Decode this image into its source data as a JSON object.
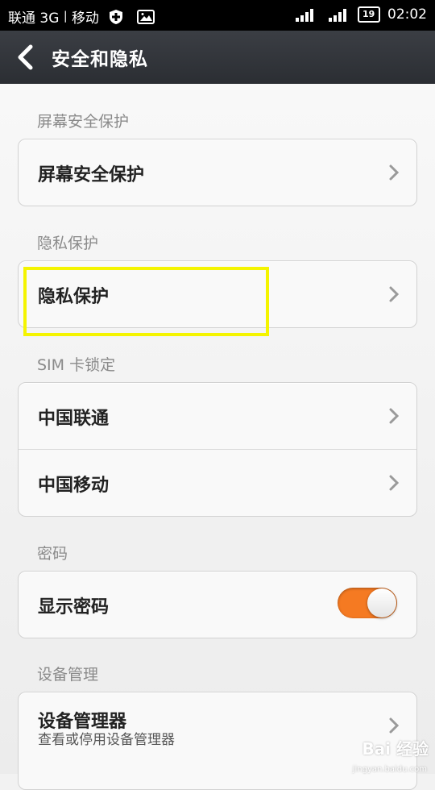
{
  "status_bar": {
    "carrier_text": "联通 3G",
    "separator": "|",
    "carrier2_text": "移动",
    "battery": "19",
    "time": "02:02"
  },
  "header": {
    "title": "安全和隐私"
  },
  "sections": [
    {
      "label": "屏幕安全保护",
      "rows": [
        {
          "label": "屏幕安全保护"
        }
      ]
    },
    {
      "label": "隐私保护",
      "rows": [
        {
          "label": "隐私保护"
        }
      ]
    },
    {
      "label": "SIM 卡锁定",
      "rows": [
        {
          "label": "中国联通"
        },
        {
          "label": "中国移动"
        }
      ]
    },
    {
      "label": "密码",
      "rows": [
        {
          "label": "显示密码",
          "toggle_on": true
        }
      ]
    },
    {
      "label": "设备管理",
      "rows": [
        {
          "label": "设备管理器",
          "sublabel": "查看或停用设备管理器"
        }
      ]
    }
  ],
  "colors": {
    "accent_toggle": "#f57a22",
    "highlight_box": "#f4f400"
  },
  "watermark": {
    "text": "Bai 经验",
    "url_text": "jingyan.baidu.com"
  }
}
